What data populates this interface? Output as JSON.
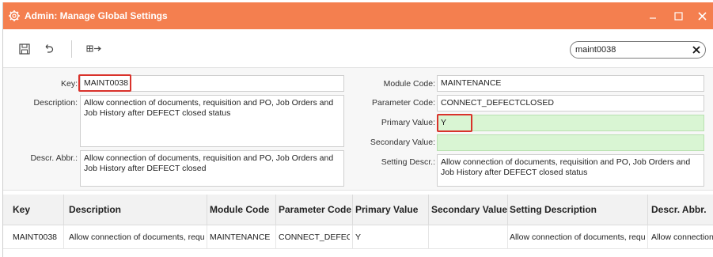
{
  "window": {
    "title": "Admin: Manage Global Settings",
    "accent_color": "#f47f4f"
  },
  "toolbar": {
    "icons": [
      "save-icon",
      "undo-icon",
      "export-icon"
    ],
    "search_value": "maint0038"
  },
  "form": {
    "key_label": "Key:",
    "key_value": "MAINT0038",
    "description_label": "Description:",
    "description_value": "Allow connection of documents, requisition and PO, Job Orders and Job History after DEFECT closed status",
    "descr_abbr_label": "Descr. Abbr.:",
    "descr_abbr_value": "Allow connection of documents, requisition and PO, Job Orders and Job History after DEFECT closed",
    "module_code_label": "Module Code:",
    "module_code_value": "MAINTENANCE",
    "parameter_code_label": "Parameter Code:",
    "parameter_code_value": "CONNECT_DEFECTCLOSED",
    "primary_value_label": "Primary Value:",
    "primary_value_value": "Y",
    "secondary_value_label": "Secondary Value:",
    "secondary_value_value": "",
    "setting_descr_label": "Setting Descr.:",
    "setting_descr_value": "Allow connection of documents, requisition and PO, Job Orders and Job History after DEFECT closed status",
    "highlight_color": "#d9322b",
    "required_field_color": "#d9f5d3"
  },
  "grid": {
    "columns": [
      "Key",
      "Description",
      "Module Code",
      "Parameter Code",
      "Primary Value",
      "Secondary Value",
      "Setting Description",
      "Descr. Abbr."
    ],
    "rows": [
      [
        "MAINT0038",
        "Allow connection of documents, requis",
        "MAINTENANCE",
        "CONNECT_DEFECTCL",
        "Y",
        "",
        "Allow connection of documents, requis",
        "Allow connection"
      ]
    ]
  }
}
